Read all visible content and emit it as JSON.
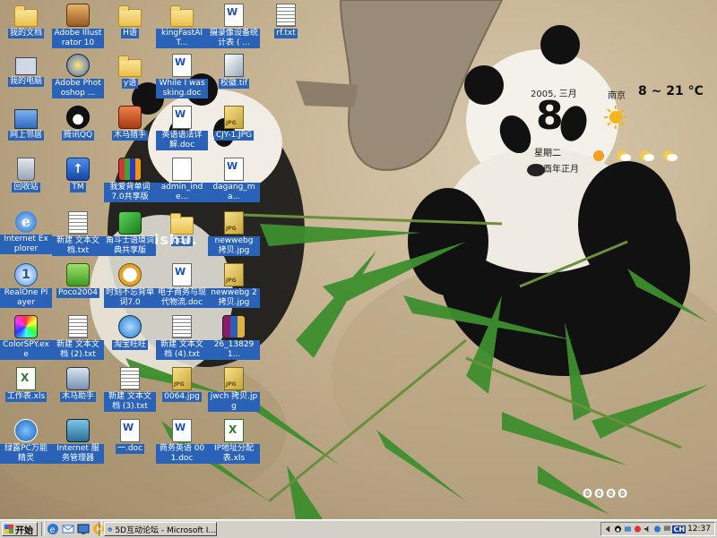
{
  "desktop": {
    "icons": [
      {
        "label": "我的文档",
        "kind": "folder"
      },
      {
        "label": "我的电脑",
        "kind": "computer"
      },
      {
        "label": "网上邻居",
        "kind": "network"
      },
      {
        "label": "回收站",
        "kind": "recycle"
      },
      {
        "label": "Internet Explorer",
        "kind": "ie"
      },
      {
        "label": "RealOne Player",
        "kind": "realone"
      },
      {
        "label": "ColorSPY.exe",
        "kind": "colorspy"
      },
      {
        "label": "工作表.xls",
        "kind": "xls"
      },
      {
        "label": "绿露PC万能精灵",
        "kind": "smurf"
      },
      {
        "label": "Adobe Illustrator 10",
        "kind": "illustrator"
      },
      {
        "label": "Adobe Photoshop ...",
        "kind": "photoshop"
      },
      {
        "label": "腾讯QQ",
        "kind": "qq"
      },
      {
        "label": "TM",
        "kind": "tm"
      },
      {
        "label": "新建 文本文档.txt",
        "kind": "txt"
      },
      {
        "label": "Poco2004",
        "kind": "poco"
      },
      {
        "label": "新建 文本文档 (2).txt",
        "kind": "txt"
      },
      {
        "label": "木马助手",
        "kind": "horse"
      },
      {
        "label": "Internet 服务管理器",
        "kind": "iis"
      },
      {
        "label": "H语",
        "kind": "folder"
      },
      {
        "label": "y语",
        "kind": "folder"
      },
      {
        "label": "木马猎手",
        "kind": "hunter"
      },
      {
        "label": "我爱背单词 7.0共享版",
        "kind": "books"
      },
      {
        "label": "角斗士语境词典共享版",
        "kind": "gladiator"
      },
      {
        "label": "时刻不忘背单词7.0",
        "kind": "clock"
      },
      {
        "label": "淘宝旺旺",
        "kind": "wangwang"
      },
      {
        "label": "新建 文本文档 (3).txt",
        "kind": "txt"
      },
      {
        "label": "一.doc",
        "kind": "doc"
      },
      {
        "label": "kingFastAIT...",
        "kind": "folder"
      },
      {
        "label": "While I was sking.doc",
        "kind": "doc"
      },
      {
        "label": "英语语法详解.doc",
        "kind": "doc"
      },
      {
        "label": "admin_inde...",
        "kind": "web"
      },
      {
        "label": "qcwl",
        "kind": "folder"
      },
      {
        "label": "电子商务与现代物流.doc",
        "kind": "doc"
      },
      {
        "label": "新建 文本文档 (4).txt",
        "kind": "txt"
      },
      {
        "label": "0064.jpg",
        "kind": "img"
      },
      {
        "label": "商务英语 001.doc",
        "kind": "doc"
      },
      {
        "label": "摄录像设备统计表 ( ...",
        "kind": "doc"
      },
      {
        "label": "校徽.tif",
        "kind": "tif"
      },
      {
        "label": "CJY-1.JPG",
        "kind": "img"
      },
      {
        "label": "dagang_ma...",
        "kind": "doc"
      },
      {
        "label": "newwebg 拷贝.jpg",
        "kind": "img"
      },
      {
        "label": "newwebg 2拷贝.jpg",
        "kind": "img"
      },
      {
        "label": "26_138291...",
        "kind": "rar"
      },
      {
        "label": "jwch 拷贝.jpg",
        "kind": "img"
      },
      {
        "label": "IP地址分配表.xls",
        "kind": "xls"
      },
      {
        "label": "rf.txt",
        "kind": "txt"
      }
    ]
  },
  "gadget": {
    "date_line": "2005, 三月",
    "day": "8",
    "weekday": "星期二",
    "lunar": "乙酉年正月",
    "city": "南京",
    "temperature": "8 ~ 21 °C"
  },
  "watermark": "ishu.",
  "brand_mark": "ʘʘʘʘ",
  "taskbar": {
    "start_label": "开始",
    "task_label": "5D互动论坛 - Microsoft I...",
    "lang": "CH",
    "clock": "12:37"
  },
  "colors": {
    "label_bg": "#2a62b8",
    "taskbar": "#d4d0c8"
  }
}
